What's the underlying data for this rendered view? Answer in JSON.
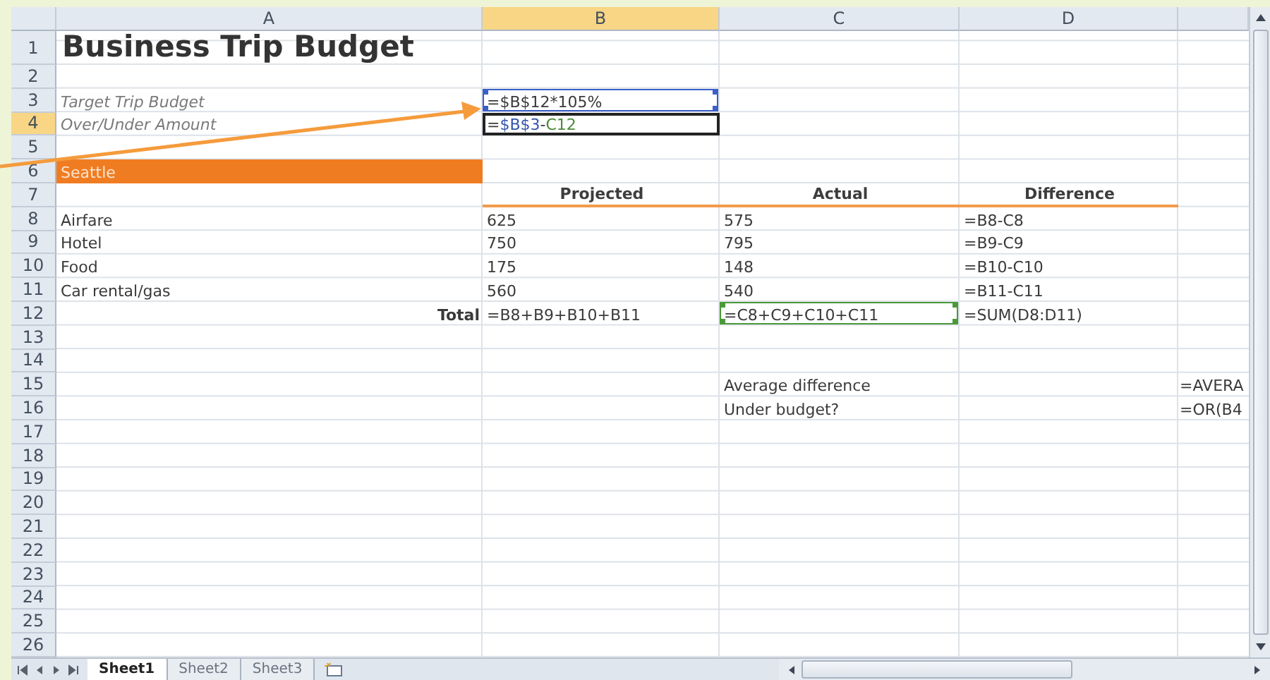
{
  "columns": [
    {
      "label": "A",
      "selected": false
    },
    {
      "label": "B",
      "selected": true
    },
    {
      "label": "C",
      "selected": false
    },
    {
      "label": "D",
      "selected": false
    }
  ],
  "rows": [
    {
      "header": "1",
      "selected": false,
      "a": {
        "kind": "title",
        "text": "Business Trip Budget"
      }
    },
    {
      "header": "2",
      "selected": false
    },
    {
      "header": "3",
      "selected": false,
      "a": {
        "kind": "italic",
        "text": "Target Trip Budget"
      },
      "b": {
        "kind": "text",
        "text": "=$B$12*105%",
        "color": "#3a5fc8"
      }
    },
    {
      "header": "4",
      "selected": true,
      "a": {
        "kind": "italic",
        "text": "Over/Under Amount"
      },
      "b": {
        "kind": "text",
        "selected": true,
        "parts": [
          {
            "text": "="
          },
          {
            "text": "$B$3",
            "color": "#3355aa"
          },
          {
            "text": "-"
          },
          {
            "text": "C12",
            "color": "#4a8a3a"
          }
        ]
      }
    },
    {
      "header": "5",
      "selected": false
    },
    {
      "header": "6",
      "selected": false,
      "a": {
        "kind": "band",
        "text": "Seattle"
      }
    },
    {
      "header": "7",
      "selected": false,
      "b": {
        "kind": "heading",
        "text": "Projected"
      },
      "c": {
        "kind": "heading",
        "text": "Actual"
      },
      "d": {
        "kind": "heading",
        "text": "Difference"
      }
    },
    {
      "header": "8",
      "selected": false,
      "a": {
        "kind": "text",
        "text": "Airfare"
      },
      "b": {
        "kind": "text",
        "text": "625"
      },
      "c": {
        "kind": "text",
        "text": "575"
      },
      "d": {
        "kind": "text",
        "text": "=B8-C8"
      }
    },
    {
      "header": "9",
      "selected": false,
      "a": {
        "kind": "text",
        "text": "Hotel"
      },
      "b": {
        "kind": "text",
        "text": "750"
      },
      "c": {
        "kind": "text",
        "text": "795"
      },
      "d": {
        "kind": "text",
        "text": "=B9-C9"
      }
    },
    {
      "header": "10",
      "selected": false,
      "a": {
        "kind": "text",
        "text": "Food"
      },
      "b": {
        "kind": "text",
        "text": "175"
      },
      "c": {
        "kind": "text",
        "text": "148"
      },
      "d": {
        "kind": "text",
        "text": "=B10-C10"
      }
    },
    {
      "header": "11",
      "selected": false,
      "a": {
        "kind": "text",
        "text": "Car rental/gas"
      },
      "b": {
        "kind": "text",
        "text": "560"
      },
      "c": {
        "kind": "text",
        "text": "540"
      },
      "d": {
        "kind": "text",
        "text": "=B11-C11"
      }
    },
    {
      "header": "12",
      "selected": false,
      "a": {
        "kind": "total",
        "text": "Total"
      },
      "b": {
        "kind": "text",
        "text": "=B8+B9+B10+B11"
      },
      "c": {
        "kind": "text",
        "text": "=C8+C9+C10+C11",
        "color": "#4a9a3a"
      },
      "d": {
        "kind": "text",
        "text": "=SUM(D8:D11)"
      }
    },
    {
      "header": "13",
      "selected": false
    },
    {
      "header": "14",
      "selected": false
    },
    {
      "header": "15",
      "selected": false,
      "c": {
        "kind": "text",
        "text": "Average difference"
      },
      "e": {
        "kind": "text",
        "text": "=AVERA"
      }
    },
    {
      "header": "16",
      "selected": false,
      "c": {
        "kind": "text",
        "text": "Under budget?"
      },
      "e": {
        "kind": "text",
        "text": "=OR(B4"
      }
    },
    {
      "header": "17",
      "selected": false
    },
    {
      "header": "18",
      "selected": false
    },
    {
      "header": "19",
      "selected": false
    },
    {
      "header": "20",
      "selected": false
    },
    {
      "header": "21",
      "selected": false
    },
    {
      "header": "22",
      "selected": false
    },
    {
      "header": "23",
      "selected": false
    },
    {
      "header": "24",
      "selected": false
    },
    {
      "header": "25",
      "selected": false
    },
    {
      "header": "26",
      "selected": false
    }
  ],
  "sheet_tabs": [
    {
      "label": "Sheet1",
      "selected": true
    },
    {
      "label": "Sheet2",
      "selected": false
    },
    {
      "label": "Sheet3",
      "selected": false
    }
  ]
}
